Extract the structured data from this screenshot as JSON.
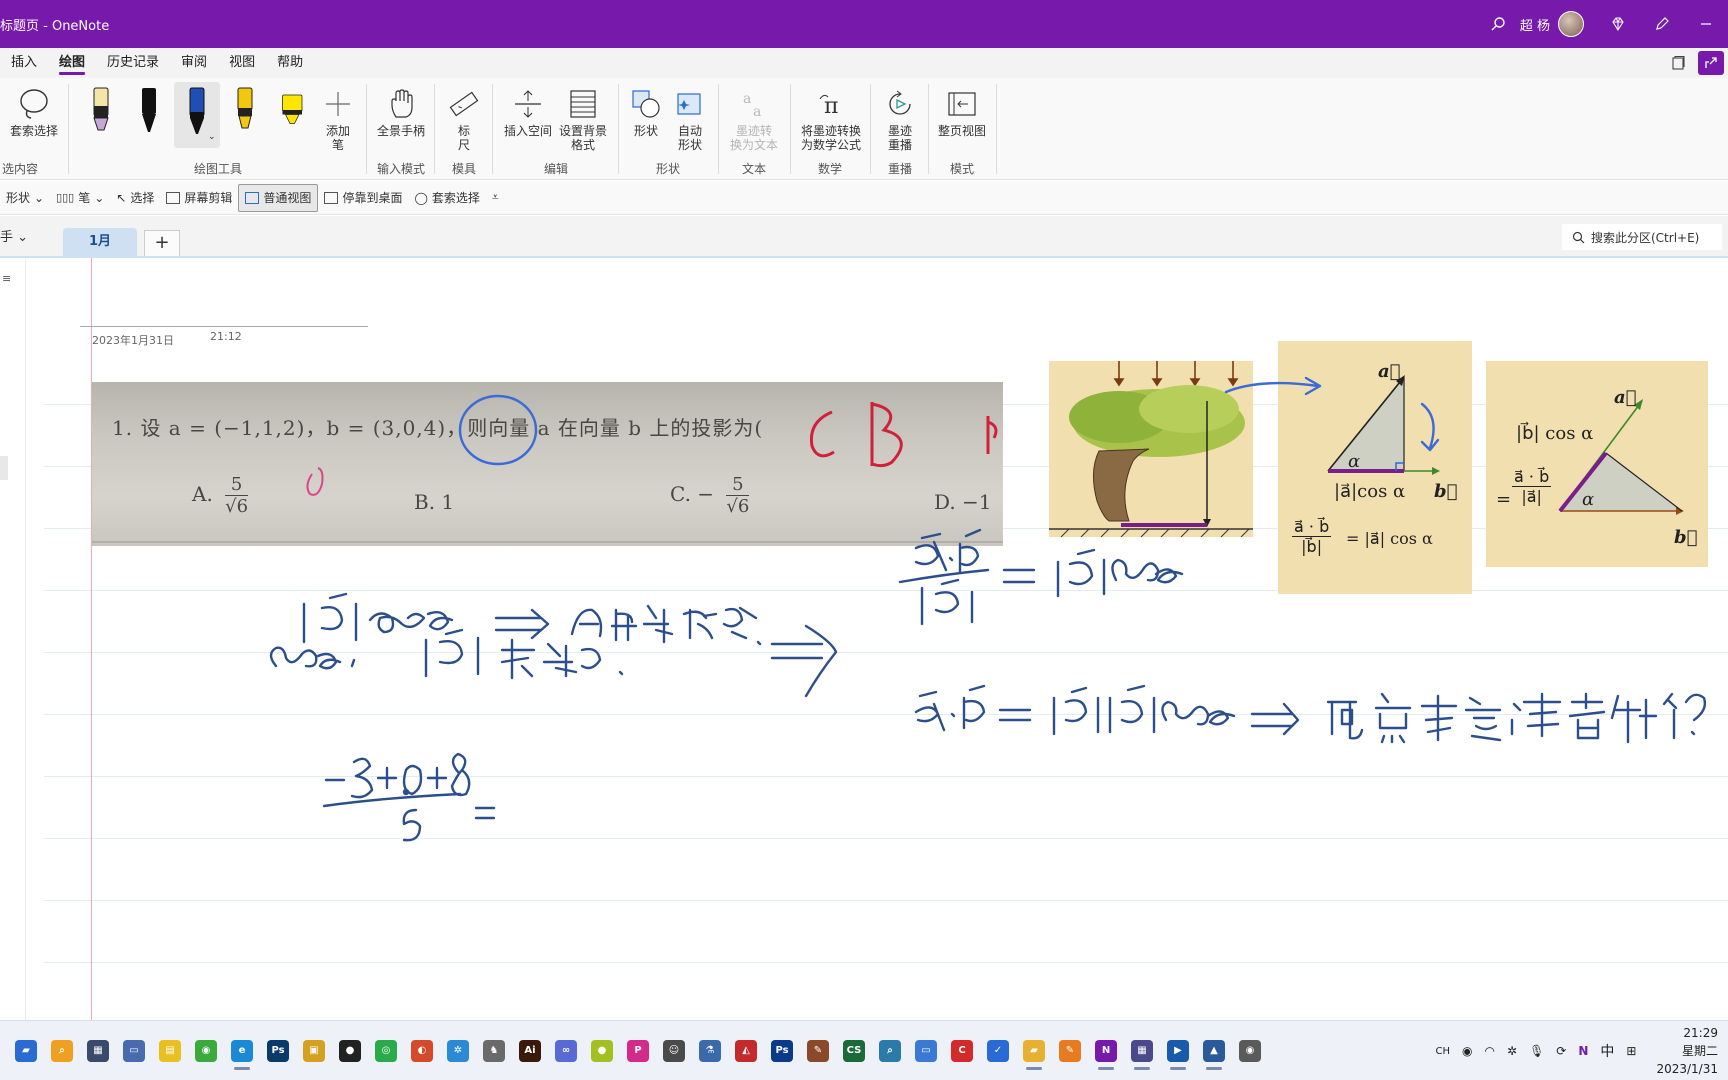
{
  "titlebar": {
    "title": "标题页  -  OneNote",
    "user_name": "超 杨",
    "accent": "#7719aa"
  },
  "menubar": {
    "tabs": [
      "插入",
      "绘图",
      "历史记录",
      "审阅",
      "视图",
      "帮助"
    ],
    "active_tab": "绘图"
  },
  "ribbon": {
    "lasso_label": "套索选择",
    "add_pen_label": "添加\n笔",
    "full_hand_label": "全景手柄",
    "ruler_label": "标\n尺",
    "insert_space_label": "插入空间",
    "bg_format_label": "设置背景\n格式",
    "shapes_label": "形状",
    "auto_shape_label": "自动\n形状",
    "ink_to_text_label": "墨迹转\n换为文本",
    "ink_to_math_label": "将墨迹转换\n为数学公式",
    "ink_replay_label": "墨迹\n重播",
    "full_page_label": "整页视图",
    "groups": {
      "select": "选内容",
      "tools": "绘图工具",
      "input": "输入模式",
      "template": "模具",
      "edit": "编辑",
      "shape": "形状",
      "text": "文本",
      "math": "数学",
      "replay": "重播",
      "mode": "模式"
    },
    "pens": [
      {
        "name": "pen-1",
        "color": "#c8a7d6"
      },
      {
        "name": "pen-2",
        "color": "#111111"
      },
      {
        "name": "pen-3",
        "color": "#1f4fb3"
      },
      {
        "name": "highlighter-1",
        "color": "#f2c80f"
      },
      {
        "name": "highlighter-2",
        "color": "#ffe600"
      }
    ]
  },
  "qat": {
    "items": [
      "形状",
      "笔",
      "选择",
      "屏幕剪辑",
      "普通视图",
      "停靠到桌面",
      "套索选择"
    ],
    "selected": "普通视图"
  },
  "sections": {
    "notebook": "手",
    "tabs": [
      "1月"
    ],
    "add": "+",
    "search_placeholder": "搜索此分区(Ctrl+E)"
  },
  "page": {
    "date": "2023年1月31日",
    "time": "21:12",
    "question_text": "1. 设 a = (−1,1,2)，b = (3,0,4)，则向量 a 在向量 b 上的投影为(",
    "options": {
      "a_prefix": "A.",
      "a_num": "5",
      "a_den": "√6",
      "b": "B. 1",
      "c_prefix": "C. −",
      "c_num": "5",
      "c_den": "√6",
      "d": "D. −1"
    },
    "fig2": {
      "a": "a⃗",
      "b": "b⃗",
      "alpha": "α",
      "proj": "|a⃗|cos α",
      "formula_num": "a⃗ · b⃗",
      "formula_den": "|b⃗|",
      "formula_rhs": "= |a⃗| cos α"
    },
    "fig3": {
      "a": "a⃗",
      "b": "b⃗",
      "alpha": "α",
      "top": "|b⃗| cos α",
      "num": "a⃗ · b⃗",
      "den": "|a⃗|",
      "eq": "="
    }
  },
  "taskbar": {
    "lang": "中",
    "time": "21:29",
    "weekday": "星期二",
    "date": "2023/1/31",
    "ime": "CH"
  }
}
